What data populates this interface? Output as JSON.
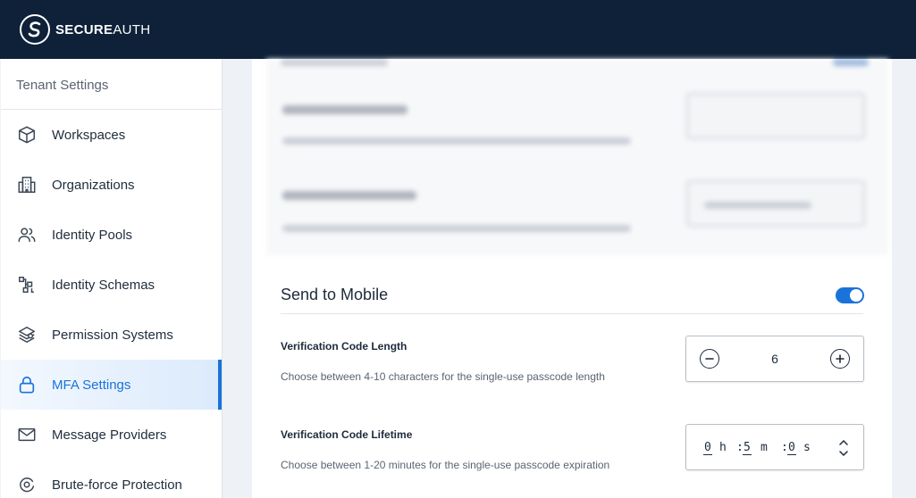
{
  "app": {
    "brand_bold": "SECURE",
    "brand_light": "AUTH"
  },
  "sidebar": {
    "header": "Tenant Settings",
    "items": [
      {
        "label": "Workspaces",
        "icon": "cube-icon"
      },
      {
        "label": "Organizations",
        "icon": "building-icon"
      },
      {
        "label": "Identity Pools",
        "icon": "users-icon"
      },
      {
        "label": "Identity Schemas",
        "icon": "schema-icon"
      },
      {
        "label": "Permission Systems",
        "icon": "layers-icon"
      },
      {
        "label": "MFA Settings",
        "icon": "lock-icon",
        "active": true
      },
      {
        "label": "Message Providers",
        "icon": "envelope-icon"
      },
      {
        "label": "Brute-force Protection",
        "icon": "shield-target-icon"
      }
    ]
  },
  "main": {
    "section_title": "Send to Mobile",
    "toggle_on": true,
    "code_length": {
      "label": "Verification Code Length",
      "help": "Choose between 4-10 characters for the single-use passcode length",
      "value": "6"
    },
    "code_lifetime": {
      "label": "Verification Code Lifetime",
      "help": "Choose between 1-20 minutes for the single-use passcode expiration",
      "hours": "0",
      "hours_unit": "h",
      "minutes": "5",
      "minutes_unit": "m",
      "seconds": "0",
      "seconds_unit": "s",
      "separator": ":"
    }
  },
  "colors": {
    "topbar": "#0e2139",
    "accent": "#1a73d9",
    "sidebar_active_bg": "#dbeafc"
  }
}
